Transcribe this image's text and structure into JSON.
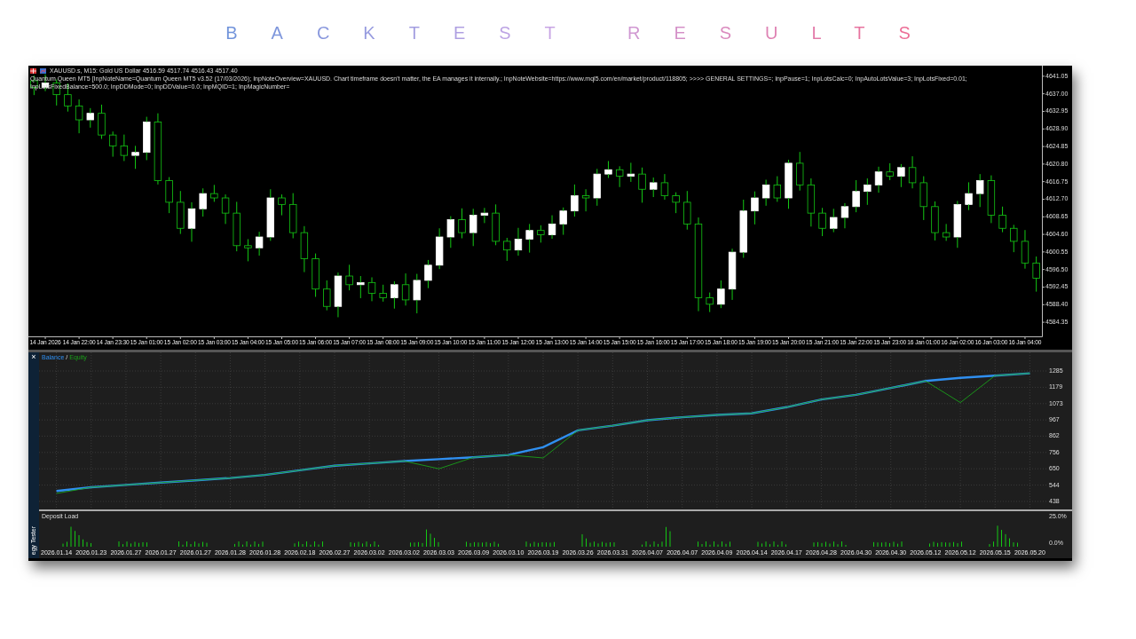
{
  "title": "BACKTEST RESULTS",
  "price_chart": {
    "symbol_line": "XAUUSD.s, M15:  Gold US Dollar  4516.59 4517.74 4516.43 4517.40",
    "expert_line": "Quantum Queen MT5 [InpNoteName=Quantum Queen MT5 v3.52 (17/03/2026); InpNoteOverview=XAUUSD. Chart timeframe doesn't matter, the EA manages it internally.; InpNoteWebsite=https://www.mql5.com/en/market/product/118805; >>>> GENERAL SETTINGS=; InpPause=1; InpLotsCalc=0; InpAutoLotsValue=3; InpLotsFixed=0.01; InpLotsFixedBalance=500.0; InpDDMode=0; InpDDValue=0.0; InpMQID=1; InpMagicNumber=",
    "chart_data": {
      "type": "candlestick",
      "categories": [
        null,
        "14 Jan 2026",
        null,
        null,
        "14 Jan 22:00",
        null,
        null,
        "14 Jan 23:30",
        null,
        null,
        "15 Jan 01:00",
        null,
        null,
        "15 Jan 02:00",
        null,
        null,
        "15 Jan 03:00",
        null,
        null,
        "15 Jan 04:00",
        null,
        null,
        "15 Jan 05:00",
        null,
        null,
        "15 Jan 06:00",
        null,
        null,
        "15 Jan 07:00",
        null,
        null,
        "15 Jan 08:00",
        null,
        null,
        "15 Jan 09:00",
        null,
        null,
        "15 Jan 10:00",
        null,
        null,
        "15 Jan 11:00",
        null,
        null,
        "15 Jan 12:00",
        null,
        null,
        "15 Jan 13:00",
        null,
        null,
        "15 Jan 14:00",
        null,
        null,
        "15 Jan 15:00",
        null,
        null,
        "15 Jan 16:00",
        null,
        null,
        "15 Jan 17:00",
        null,
        null,
        "15 Jan 18:00",
        null,
        null,
        "15 Jan 19:00",
        null,
        null,
        "15 Jan 20:00",
        null,
        null,
        "15 Jan 21:00",
        null,
        null,
        "15 Jan 22:00",
        null,
        null,
        "15 Jan 23:00",
        null,
        null,
        "16 Jan 01:00",
        null,
        null,
        "16 Jan 02:00",
        null,
        null,
        "16 Jan 03:00",
        null,
        null,
        "16 Jan 04:00",
        null
      ],
      "ohlc": [
        [
          4640.0,
          4641.2,
          4636.7,
          4638.5
        ],
        [
          4638.5,
          4641.5,
          4637.6,
          4639.5
        ],
        [
          4639.5,
          4640.3,
          4634.3,
          4636.8
        ],
        [
          4636.8,
          4639.4,
          4632.9,
          4634.2
        ],
        [
          4634.2,
          4635.7,
          4627.9,
          4631.0
        ],
        [
          4631.0,
          4633.7,
          4629.2,
          4632.5
        ],
        [
          4632.5,
          4634.5,
          4626.6,
          4627.5
        ],
        [
          4627.5,
          4628.3,
          4622.5,
          4625.0
        ],
        [
          4625.0,
          4627.6,
          4621.5,
          4622.8
        ],
        [
          4622.8,
          4625.0,
          4619.7,
          4623.5
        ],
        [
          4623.5,
          4631.7,
          4621.7,
          4630.5
        ],
        [
          4630.5,
          4632.5,
          4616.1,
          4617.0
        ],
        [
          4617.0,
          4617.8,
          4609.5,
          4612.0
        ],
        [
          4612.0,
          4614.6,
          4604.7,
          4606.0
        ],
        [
          4606.0,
          4612.0,
          4602.9,
          4610.5
        ],
        [
          4610.5,
          4615.2,
          4608.7,
          4614.0
        ],
        [
          4614.0,
          4616.0,
          4612.1,
          4613.0
        ],
        [
          4613.0,
          4613.8,
          4607.0,
          4609.5
        ],
        [
          4609.5,
          4612.1,
          4600.7,
          4602.0
        ],
        [
          4602.0,
          4603.5,
          4598.4,
          4601.5
        ],
        [
          4601.5,
          4605.2,
          4599.7,
          4604.0
        ],
        [
          4604.0,
          4615.0,
          4603.1,
          4613.0
        ],
        [
          4613.0,
          4613.8,
          4609.0,
          4611.5
        ],
        [
          4611.5,
          4614.1,
          4603.7,
          4605.0
        ],
        [
          4605.0,
          4606.5,
          4595.9,
          4599.0
        ],
        [
          4599.0,
          4600.2,
          4590.2,
          4592.0
        ],
        [
          4592.0,
          4594.0,
          4587.1,
          4588.0
        ],
        [
          4588.0,
          4595.8,
          4585.5,
          4595.0
        ],
        [
          4595.0,
          4597.6,
          4591.7,
          4593.0
        ],
        [
          4593.0,
          4595.0,
          4589.9,
          4593.5
        ],
        [
          4593.5,
          4594.7,
          4589.2,
          4591.0
        ],
        [
          4591.0,
          4593.0,
          4589.1,
          4590.0
        ],
        [
          4590.0,
          4593.8,
          4587.5,
          4593.0
        ],
        [
          4593.0,
          4595.6,
          4588.2,
          4589.5
        ],
        [
          4589.5,
          4595.5,
          4586.4,
          4594.0
        ],
        [
          4594.0,
          4598.7,
          4592.2,
          4597.5
        ],
        [
          4597.5,
          4606.0,
          4596.6,
          4604.0
        ],
        [
          4604.0,
          4608.8,
          4601.5,
          4608.0
        ],
        [
          4608.0,
          4610.6,
          4603.7,
          4605.0
        ],
        [
          4605.0,
          4610.5,
          4601.9,
          4609.0
        ],
        [
          4609.0,
          4610.7,
          4607.2,
          4609.5
        ],
        [
          4609.5,
          4611.5,
          4602.1,
          4603.0
        ],
        [
          4603.0,
          4603.8,
          4598.5,
          4601.0
        ],
        [
          4601.0,
          4606.1,
          4599.7,
          4603.5
        ],
        [
          4603.5,
          4607.0,
          4600.4,
          4605.5
        ],
        [
          4605.5,
          4606.7,
          4602.7,
          4604.5
        ],
        [
          4604.5,
          4609.0,
          4603.6,
          4607.0
        ],
        [
          4607.0,
          4610.8,
          4604.5,
          4610.0
        ],
        [
          4610.0,
          4616.1,
          4608.7,
          4613.5
        ],
        [
          4613.5,
          4615.0,
          4609.9,
          4613.0
        ],
        [
          4613.0,
          4619.7,
          4611.2,
          4618.5
        ],
        [
          4618.5,
          4621.5,
          4617.6,
          4619.5
        ],
        [
          4619.5,
          4620.3,
          4615.5,
          4618.0
        ],
        [
          4618.0,
          4621.1,
          4616.7,
          4618.5
        ],
        [
          4618.5,
          4620.0,
          4611.9,
          4615.0
        ],
        [
          4615.0,
          4617.7,
          4613.2,
          4616.5
        ],
        [
          4616.5,
          4618.5,
          4612.6,
          4613.5
        ],
        [
          4613.5,
          4614.3,
          4609.5,
          4612.0
        ],
        [
          4612.0,
          4614.6,
          4605.7,
          4607.0
        ],
        [
          4607.0,
          4608.5,
          4586.9,
          4590.0
        ],
        [
          4590.0,
          4591.2,
          4586.7,
          4588.5
        ],
        [
          4588.5,
          4594.0,
          4587.6,
          4592.0
        ],
        [
          4592.0,
          4601.3,
          4589.5,
          4600.5
        ],
        [
          4600.5,
          4612.6,
          4599.2,
          4610.0
        ],
        [
          4610.0,
          4614.5,
          4606.9,
          4613.0
        ],
        [
          4613.0,
          4617.2,
          4611.2,
          4616.0
        ],
        [
          4616.0,
          4618.0,
          4612.1,
          4613.0
        ],
        [
          4613.0,
          4621.8,
          4610.5,
          4621.0
        ],
        [
          4621.0,
          4623.6,
          4614.7,
          4616.0
        ],
        [
          4616.0,
          4617.5,
          4606.4,
          4609.5
        ],
        [
          4609.5,
          4610.7,
          4604.2,
          4606.0
        ],
        [
          4606.0,
          4610.5,
          4605.1,
          4608.5
        ],
        [
          4608.5,
          4611.8,
          4606.0,
          4611.0
        ],
        [
          4611.0,
          4617.1,
          4609.7,
          4614.5
        ],
        [
          4614.5,
          4617.5,
          4611.4,
          4616.0
        ],
        [
          4616.0,
          4620.2,
          4614.2,
          4619.0
        ],
        [
          4619.0,
          4621.0,
          4617.1,
          4618.0
        ],
        [
          4618.0,
          4620.8,
          4615.5,
          4620.0
        ],
        [
          4620.0,
          4622.6,
          4615.2,
          4616.5
        ],
        [
          4616.5,
          4618.0,
          4607.9,
          4611.0
        ],
        [
          4611.0,
          4612.2,
          4603.2,
          4605.0
        ],
        [
          4605.0,
          4607.0,
          4603.1,
          4604.0
        ],
        [
          4604.0,
          4612.3,
          4601.5,
          4611.5
        ],
        [
          4611.5,
          4616.6,
          4610.2,
          4614.0
        ],
        [
          4614.0,
          4618.5,
          4610.9,
          4617.0
        ],
        [
          4617.0,
          4618.2,
          4607.2,
          4609.0
        ],
        [
          4609.0,
          4611.0,
          4605.1,
          4606.0
        ],
        [
          4606.0,
          4606.8,
          4600.5,
          4603.0
        ],
        [
          4603.0,
          4605.6,
          4596.7,
          4598.0
        ],
        [
          4598.0,
          4599.5,
          4591.4,
          4594.5
        ]
      ],
      "yticks": [
        {
          "value": 4641.05,
          "label": "4641.05"
        },
        {
          "value": 4637.0,
          "label": "4637.00"
        },
        {
          "value": 4632.95,
          "label": "4632.95"
        },
        {
          "value": 4628.9,
          "label": "4628.90"
        },
        {
          "value": 4624.85,
          "label": "4624.85"
        },
        {
          "value": 4620.8,
          "label": "4620.80"
        },
        {
          "value": 4616.75,
          "label": "4616.75"
        },
        {
          "value": 4612.7,
          "label": "4612.70"
        },
        {
          "value": 4608.65,
          "label": "4608.65"
        },
        {
          "value": 4604.6,
          "label": "4604.60"
        },
        {
          "value": 4600.55,
          "label": "4600.55"
        },
        {
          "value": 4596.5,
          "label": "4596.50"
        },
        {
          "value": 4592.45,
          "label": "4592.45"
        },
        {
          "value": 4588.4,
          "label": "4588.40"
        },
        {
          "value": 4584.35,
          "label": "4584.35"
        }
      ],
      "ylim": [
        4581.3,
        4643.48
      ]
    }
  },
  "tester": {
    "close_label": "×",
    "side_label": "egy Tester",
    "balance_chart": {
      "legend_separator": "/",
      "chart_data": {
        "type": "line",
        "categories": [
          "2026.01.14",
          "2026.01.23",
          "2026.01.27",
          "2026.01.27",
          "2026.01.27",
          "2026.01.28",
          "2026.01.28",
          "2026.02.18",
          "2026.02.27",
          "2026.03.02",
          "2026.03.02",
          "2026.03.03",
          "2026.03.09",
          "2026.03.10",
          "2026.03.19",
          "2026.03.26",
          "2026.03.31",
          "2026.04.07",
          "2026.04.07",
          "2026.04.09",
          "2026.04.14",
          "2026.04.17",
          "2026.04.28",
          "2026.04.30",
          "2026.04.30",
          "2026.05.12",
          "2026.05.12",
          "2026.05.15",
          "2026.05.20"
        ],
        "series": [
          {
            "name": "Balance",
            "color": "#2f8ff0",
            "values": [
              505,
              530,
              545,
              560,
              575,
              590,
              610,
              640,
              670,
              685,
              700,
              712,
              725,
              740,
              790,
              900,
              930,
              965,
              985,
              1000,
              1010,
              1050,
              1100,
              1130,
              1175,
              1220,
              1240,
              1255,
              1270
            ]
          },
          {
            "name": "Equity",
            "color": "#1aa01a",
            "values": [
              490,
              530,
              545,
              560,
              575,
              590,
              610,
              640,
              670,
              685,
              700,
              650,
              725,
              740,
              720,
              900,
              930,
              965,
              985,
              1000,
              1010,
              1050,
              1100,
              1130,
              1175,
              1220,
              1080,
              1255,
              1270
            ]
          }
        ],
        "ylim": [
          386,
          1406
        ],
        "yticks": [
          1285,
          1179,
          1073,
          967,
          862,
          756,
          650,
          544,
          438
        ],
        "grid": true
      }
    },
    "deposit_load": {
      "title": "Deposit Load",
      "axis_labels": [
        "25.0%",
        "0.0%"
      ]
    }
  }
}
